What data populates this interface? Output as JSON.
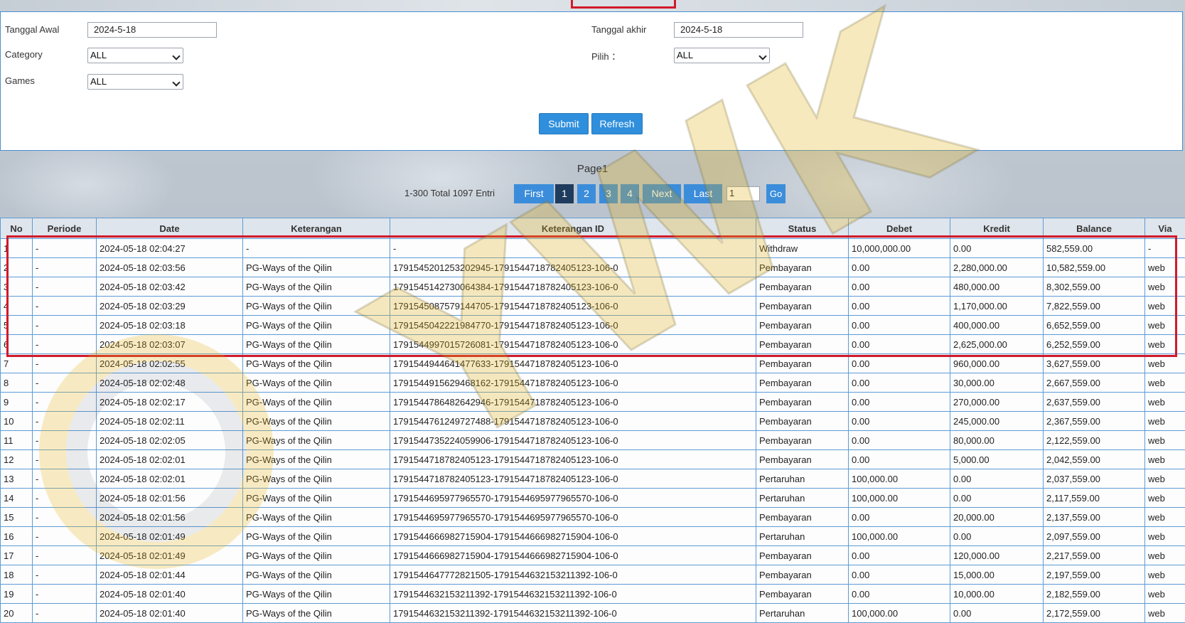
{
  "filters": {
    "start_date_label": "Tanggal Awal",
    "start_date_value": "2024-5-18",
    "end_date_label": "Tanggal akhir",
    "end_date_value": "2024-5-18",
    "category_label": "Category",
    "category_value": "ALL",
    "pilih_label": "Pilih ：",
    "pilih_value": "ALL",
    "games_label": "Games",
    "games_value": "ALL",
    "submit_label": "Submit",
    "refresh_label": "Refresh"
  },
  "pagination": {
    "title": "Page1",
    "entries_text": "1-300 Total 1097 Entri",
    "first_label": "First",
    "pages": [
      "1",
      "2",
      "3",
      "4"
    ],
    "active_page": "1",
    "next_label": "Next",
    "last_label": "Last",
    "page_input_value": "1",
    "go_label": "Go"
  },
  "table": {
    "headers": [
      "No",
      "Periode",
      "Date",
      "Keterangan",
      "Keterangan ID",
      "Status",
      "Debet",
      "Kredit",
      "Balance",
      "Via"
    ],
    "rows": [
      [
        "1",
        "-",
        "2024-05-18 02:04:27",
        "-",
        "-",
        "Withdraw",
        "10,000,000.00",
        "0.00",
        "582,559.00",
        "-"
      ],
      [
        "2",
        "-",
        "2024-05-18 02:03:56",
        "PG-Ways of the Qilin",
        "1791545201253202945-1791544718782405123-106-0",
        "Pembayaran",
        "0.00",
        "2,280,000.00",
        "10,582,559.00",
        "web"
      ],
      [
        "3",
        "-",
        "2024-05-18 02:03:42",
        "PG-Ways of the Qilin",
        "1791545142730064384-1791544718782405123-106-0",
        "Pembayaran",
        "0.00",
        "480,000.00",
        "8,302,559.00",
        "web"
      ],
      [
        "4",
        "-",
        "2024-05-18 02:03:29",
        "PG-Ways of the Qilin",
        "1791545087579144705-1791544718782405123-106-0",
        "Pembayaran",
        "0.00",
        "1,170,000.00",
        "7,822,559.00",
        "web"
      ],
      [
        "5",
        "-",
        "2024-05-18 02:03:18",
        "PG-Ways of the Qilin",
        "1791545042221984770-1791544718782405123-106-0",
        "Pembayaran",
        "0.00",
        "400,000.00",
        "6,652,559.00",
        "web"
      ],
      [
        "6",
        "-",
        "2024-05-18 02:03:07",
        "PG-Ways of the Qilin",
        "1791544997015726081-1791544718782405123-106-0",
        "Pembayaran",
        "0.00",
        "2,625,000.00",
        "6,252,559.00",
        "web"
      ],
      [
        "7",
        "-",
        "2024-05-18 02:02:55",
        "PG-Ways of the Qilin",
        "1791544944641477633-1791544718782405123-106-0",
        "Pembayaran",
        "0.00",
        "960,000.00",
        "3,627,559.00",
        "web"
      ],
      [
        "8",
        "-",
        "2024-05-18 02:02:48",
        "PG-Ways of the Qilin",
        "1791544915629468162-1791544718782405123-106-0",
        "Pembayaran",
        "0.00",
        "30,000.00",
        "2,667,559.00",
        "web"
      ],
      [
        "9",
        "-",
        "2024-05-18 02:02:17",
        "PG-Ways of the Qilin",
        "1791544786482642946-1791544718782405123-106-0",
        "Pembayaran",
        "0.00",
        "270,000.00",
        "2,637,559.00",
        "web"
      ],
      [
        "10",
        "-",
        "2024-05-18 02:02:11",
        "PG-Ways of the Qilin",
        "1791544761249727488-1791544718782405123-106-0",
        "Pembayaran",
        "0.00",
        "245,000.00",
        "2,367,559.00",
        "web"
      ],
      [
        "11",
        "-",
        "2024-05-18 02:02:05",
        "PG-Ways of the Qilin",
        "1791544735224059906-1791544718782405123-106-0",
        "Pembayaran",
        "0.00",
        "80,000.00",
        "2,122,559.00",
        "web"
      ],
      [
        "12",
        "-",
        "2024-05-18 02:02:01",
        "PG-Ways of the Qilin",
        "1791544718782405123-1791544718782405123-106-0",
        "Pembayaran",
        "0.00",
        "5,000.00",
        "2,042,559.00",
        "web"
      ],
      [
        "13",
        "-",
        "2024-05-18 02:02:01",
        "PG-Ways of the Qilin",
        "1791544718782405123-1791544718782405123-106-0",
        "Pertaruhan",
        "100,000.00",
        "0.00",
        "2,037,559.00",
        "web"
      ],
      [
        "14",
        "-",
        "2024-05-18 02:01:56",
        "PG-Ways of the Qilin",
        "1791544695977965570-1791544695977965570-106-0",
        "Pertaruhan",
        "100,000.00",
        "0.00",
        "2,117,559.00",
        "web"
      ],
      [
        "15",
        "-",
        "2024-05-18 02:01:56",
        "PG-Ways of the Qilin",
        "1791544695977965570-1791544695977965570-106-0",
        "Pembayaran",
        "0.00",
        "20,000.00",
        "2,137,559.00",
        "web"
      ],
      [
        "16",
        "-",
        "2024-05-18 02:01:49",
        "PG-Ways of the Qilin",
        "1791544666982715904-1791544666982715904-106-0",
        "Pertaruhan",
        "100,000.00",
        "0.00",
        "2,097,559.00",
        "web"
      ],
      [
        "17",
        "-",
        "2024-05-18 02:01:49",
        "PG-Ways of the Qilin",
        "1791544666982715904-1791544666982715904-106-0",
        "Pembayaran",
        "0.00",
        "120,000.00",
        "2,217,559.00",
        "web"
      ],
      [
        "18",
        "-",
        "2024-05-18 02:01:44",
        "PG-Ways of the Qilin",
        "1791544647772821505-1791544632153211392-106-0",
        "Pembayaran",
        "0.00",
        "15,000.00",
        "2,197,559.00",
        "web"
      ],
      [
        "19",
        "-",
        "2024-05-18 02:01:40",
        "PG-Ways of the Qilin",
        "1791544632153211392-1791544632153211392-106-0",
        "Pembayaran",
        "0.00",
        "10,000.00",
        "2,182,559.00",
        "web"
      ],
      [
        "20",
        "-",
        "2024-05-18 02:01:40",
        "PG-Ways of the Qilin",
        "1791544632153211392-1791544632153211392-106-0",
        "Pertaruhan",
        "100,000.00",
        "0.00",
        "2,172,559.00",
        "web"
      ]
    ]
  },
  "colors": {
    "accent_blue": "#2f8fdc",
    "active_page": "#1f3c5e",
    "highlight_red": "#d11a2a",
    "grid_border": "#5e9bd4"
  },
  "watermark": {
    "text": "YWK"
  }
}
